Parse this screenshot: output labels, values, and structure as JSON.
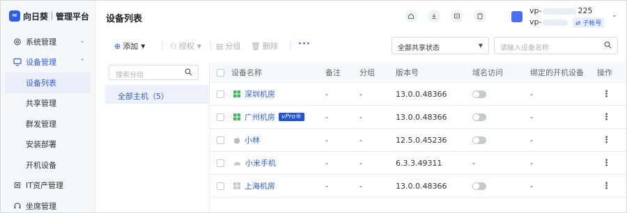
{
  "brand": {
    "name": "向日葵",
    "product": "管理平台"
  },
  "sidebar": {
    "items": [
      {
        "label": "系统管理",
        "icon": "gear-icon",
        "chevron": "⌄"
      },
      {
        "label": "设备管理",
        "icon": "monitor-icon",
        "chevron": "⌃"
      },
      {
        "label": "IT资产管理",
        "icon": "chip-icon"
      },
      {
        "label": "坐席管理",
        "icon": "headset-icon"
      }
    ],
    "sub_items": [
      {
        "label": "设备列表"
      },
      {
        "label": "共享管理"
      },
      {
        "label": "群发管理"
      },
      {
        "label": "安装部署"
      },
      {
        "label": "开机设备"
      }
    ]
  },
  "header": {
    "title": "设备列表"
  },
  "user": {
    "name_prefix": "vp-",
    "name_suffix": "225",
    "name2_prefix": "vp-",
    "badge": "⇄ 子帐号"
  },
  "toolbar": {
    "add": "添加",
    "authorize": "授权",
    "group": "分组",
    "delete": "删除",
    "share_filter": "全部共享状态",
    "search_placeholder": "请输入设备名称"
  },
  "groups": {
    "search_placeholder": "搜索分组",
    "all": "全部主机（5）"
  },
  "table": {
    "headers": [
      "设备名称",
      "备注",
      "分组",
      "版本号",
      "域名访问",
      "绑定的开机设备",
      "操作"
    ],
    "rows": [
      {
        "name": "深圳机房",
        "os_icon": "windows-icon",
        "note": "-",
        "group": "-",
        "version": "13.0.0.48366",
        "domain": true,
        "boot": "-",
        "badge": ""
      },
      {
        "name": "广州机房",
        "os_icon": "windows-icon",
        "note": "-",
        "group": "-",
        "version": "13.0.0.48366",
        "domain": true,
        "boot": "-",
        "badge": "vPro®"
      },
      {
        "name": "小林",
        "os_icon": "apple-icon",
        "note": "-",
        "group": "-",
        "version": "12.5.0.45236",
        "domain": true,
        "boot": "-",
        "badge": ""
      },
      {
        "name": "小米手机",
        "os_icon": "android-icon",
        "note": "-",
        "group": "-",
        "version": "6.3.3.49311",
        "domain": false,
        "domain_text": "-",
        "boot": "-",
        "badge": ""
      },
      {
        "name": "上海机房",
        "os_icon": "windows-icon",
        "note": "-",
        "group": "-",
        "version": "13.0.0.48366",
        "domain": true,
        "boot": "-",
        "badge": ""
      }
    ]
  },
  "colors": {
    "accent": "#2a5cf6",
    "vpro": "#1f52d9"
  }
}
